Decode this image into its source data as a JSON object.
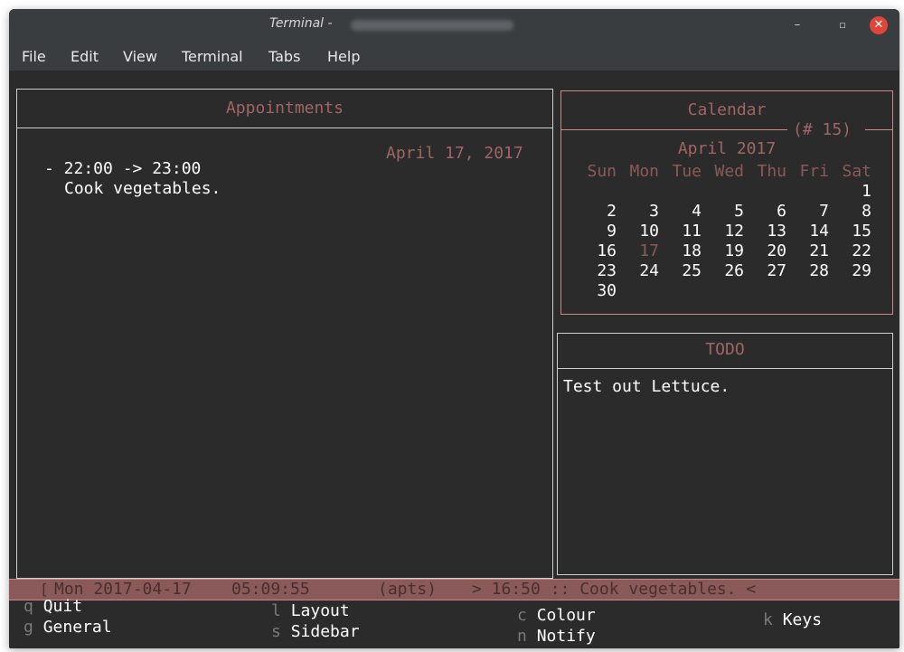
{
  "window": {
    "title": "Terminal -",
    "minimize_glyph": "–",
    "maximize_glyph": "▫",
    "close_glyph": "✕"
  },
  "menu": [
    "File",
    "Edit",
    "View",
    "Terminal",
    "Tabs",
    "Help"
  ],
  "appointments": {
    "title": "Appointments",
    "date": "April 17, 2017",
    "items": [
      {
        "time": "- 22:00 -> 23:00",
        "text": "Cook vegetables."
      }
    ]
  },
  "calendar": {
    "title": "Calendar",
    "week_label": "(# 15)",
    "month": "April 2017",
    "weekdays": [
      "Sun",
      "Mon",
      "Tue",
      "Wed",
      "Thu",
      "Fri",
      "Sat"
    ],
    "weeks": [
      [
        "",
        "",
        "",
        "",
        "",
        "",
        "1"
      ],
      [
        "2",
        "3",
        "4",
        "5",
        "6",
        "7",
        "8"
      ],
      [
        "9",
        "10",
        "11",
        "12",
        "13",
        "14",
        "15"
      ],
      [
        "16",
        "17",
        "18",
        "19",
        "20",
        "21",
        "22"
      ],
      [
        "23",
        "24",
        "25",
        "26",
        "27",
        "28",
        "29"
      ],
      [
        "30",
        "",
        "",
        "",
        "",
        "",
        ""
      ]
    ],
    "today": "17"
  },
  "todo": {
    "title": "TODO",
    "items": [
      "Test out Lettuce."
    ]
  },
  "status": {
    "date": "Mon 2017-04-17",
    "time": "05:09:55",
    "mode": "(apts)",
    "next": "> 16:50 :: Cook vegetables. <"
  },
  "keys": [
    {
      "key": "q",
      "label": "Quit"
    },
    {
      "key": "g",
      "label": "General"
    },
    {
      "key": "l",
      "label": "Layout"
    },
    {
      "key": "s",
      "label": "Sidebar"
    },
    {
      "key": "c",
      "label": "Colour"
    },
    {
      "key": "n",
      "label": "Notify"
    },
    {
      "key": "k",
      "label": "Keys"
    }
  ]
}
